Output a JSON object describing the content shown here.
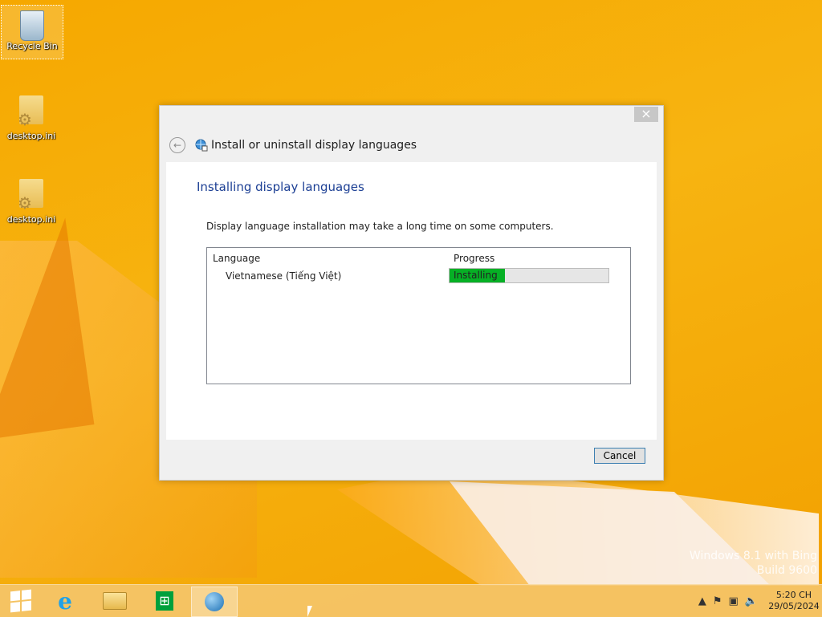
{
  "desktop": {
    "icons": [
      {
        "label": "Recycle Bin",
        "icon": "recycle-bin-icon"
      },
      {
        "label": "desktop.ini",
        "icon": "settings-file-icon"
      },
      {
        "label": "desktop.ini",
        "icon": "settings-file-icon"
      }
    ],
    "watermark": {
      "line1": "Windows 8.1 with Bing",
      "line2": "Build 9600"
    }
  },
  "window": {
    "title": "Install or uninstall display languages",
    "close_glyph": "×",
    "back_glyph": "←",
    "heading": "Installing display languages",
    "info": "Display language installation may take a long time on some computers.",
    "list": {
      "columns": [
        "Language",
        "Progress"
      ],
      "rows": [
        {
          "language": "Vietnamese (Tiếng Việt)",
          "status": "Installing",
          "progress": 0.35
        }
      ]
    },
    "cancel_label": "Cancel"
  },
  "taskbar": {
    "pinned": [
      "start-button",
      "internet-explorer",
      "file-explorer",
      "windows-store",
      "display-language-installer"
    ],
    "clock": {
      "time": "5:20 CH",
      "date": "29/05/2024"
    }
  },
  "colors": {
    "progress": "#06b025",
    "heading": "#1c3f94",
    "accent": "#f7b411"
  }
}
